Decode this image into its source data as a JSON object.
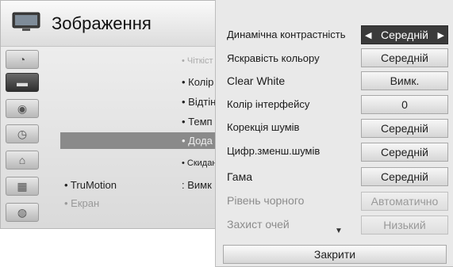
{
  "menu": {
    "title": "Зображення",
    "icons": [
      "satellite-dish-icon",
      "tv-picture-icon",
      "speaker-icon",
      "clock-icon",
      "lock-icon",
      "calendar-icon",
      "globe-icon"
    ],
    "items": [
      {
        "label": "• Чіткіст"
      },
      {
        "label": "• Колір"
      },
      {
        "label": "• Відтін"
      },
      {
        "label": "• Темп"
      },
      {
        "label": "• Дода"
      },
      {
        "label": "• Скидан"
      }
    ],
    "trumotion_label": "• TruMotion",
    "trumotion_value": ": Вимк",
    "screen_label": "• Екран"
  },
  "popup": {
    "rows": [
      {
        "label": "Динамічна контрастність",
        "value": "Середній"
      },
      {
        "label": "Яскравість кольору",
        "value": "Середній"
      },
      {
        "label": "Clear White",
        "value": "Вимк."
      },
      {
        "label": "Колір інтерфейсу",
        "value": "0"
      },
      {
        "label": "Корекція шумів",
        "value": "Середній"
      },
      {
        "label": "Цифр.зменш.шумів",
        "value": "Середній"
      },
      {
        "label": "Гама",
        "value": "Середній"
      },
      {
        "label": "Рівень чорного",
        "value": "Автоматично"
      },
      {
        "label": "Захист очей",
        "value": "Низький"
      }
    ],
    "close_label": "Закрити"
  },
  "colors": {
    "selected": "#3b3b3b",
    "highlight": "#8a8a8a",
    "panel": "#e9e9e9"
  }
}
